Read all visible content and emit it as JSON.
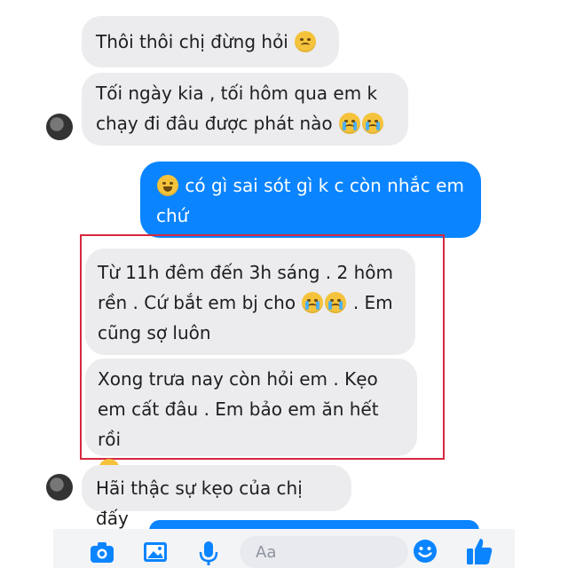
{
  "messages": [
    {
      "id": "m1",
      "from": "other",
      "text": "Thôi thôi chị đừng hỏi",
      "emoji": [
        "disappointed"
      ]
    },
    {
      "id": "m2",
      "from": "other",
      "text_lines": [
        "Tối ngày kia , tối hôm qua em k",
        "chạy đi đâu được phát nào"
      ],
      "emoji": [
        "crying",
        "crying"
      ]
    },
    {
      "id": "m3",
      "from": "me",
      "lead_emoji": "laughing",
      "text_lines": [
        "có gì sai sót gì k c còn nhắc em",
        "chứ"
      ]
    },
    {
      "id": "m4",
      "from": "other",
      "text_lines": [
        "Từ 11h đêm đến 3h sáng . 2 hôm",
        "rền . Cứ bắt em bj cho",
        ". Em",
        "cũng sợ luôn"
      ],
      "emoji": [
        "crying",
        "crying"
      ]
    },
    {
      "id": "m5",
      "from": "other",
      "text_lines": [
        "Xong trưa nay còn hỏi em . Kẹo",
        "em cất đâu . Em bảo em ăn hết rồi"
      ],
      "emoji": [
        "worried"
      ]
    },
    {
      "id": "m6",
      "from": "other",
      "text": "Hãi thậc sự kẹo của chị đấy"
    }
  ],
  "composer": {
    "placeholder": "Aa"
  },
  "toolbar_icons": [
    "camera-icon",
    "image-icon",
    "microphone-icon",
    "emoji-icon",
    "thumbs-up-icon"
  ],
  "colors": {
    "incoming_bubble": "#ececee",
    "outgoing_bubble": "#0a84ff",
    "highlight_border": "#d6283f"
  }
}
